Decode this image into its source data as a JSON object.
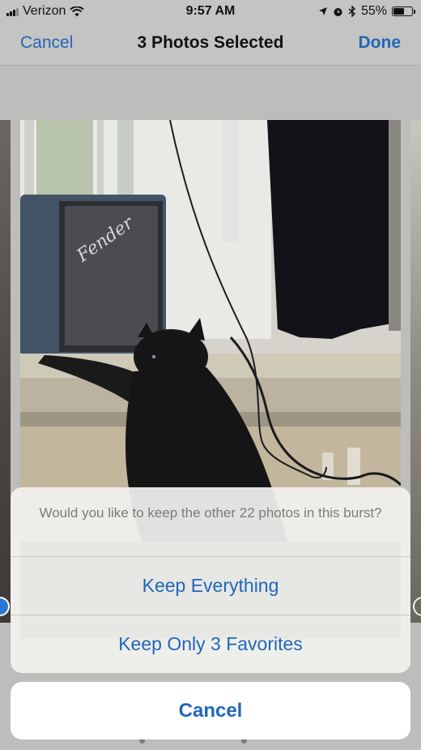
{
  "status_bar": {
    "carrier": "Verizon",
    "time": "9:57 AM",
    "battery_percent": "55%",
    "battery_level": 0.55,
    "icons": [
      "signal-bars-icon",
      "wifi-icon",
      "location-arrow-icon",
      "alarm-icon",
      "bluetooth-icon",
      "battery-icon"
    ]
  },
  "nav": {
    "cancel_label": "Cancel",
    "title": "3 Photos Selected",
    "done_label": "Done"
  },
  "photo": {
    "brand_script": "Fender",
    "selection": [
      "selected",
      "unselected"
    ]
  },
  "action_sheet": {
    "message": "Would you like to keep the other 22 photos in this burst?",
    "actions": [
      {
        "label": "Keep Everything"
      },
      {
        "label": "Keep Only 3 Favorites"
      }
    ],
    "cancel_label": "Cancel"
  },
  "colors": {
    "accent": "#2267b8",
    "dim_overlay": "#bdbdbb",
    "sheet_background": "#f1f1ef",
    "message_text": "#7b7b7b"
  }
}
